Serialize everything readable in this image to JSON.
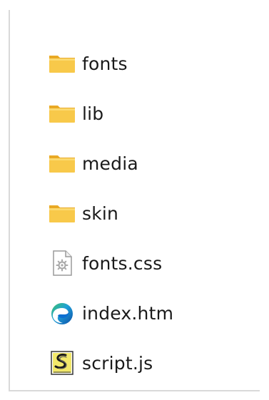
{
  "explorer": {
    "items": [
      {
        "name": "fonts",
        "type": "folder",
        "icon": "folder-icon"
      },
      {
        "name": "lib",
        "type": "folder",
        "icon": "folder-icon"
      },
      {
        "name": "media",
        "type": "folder",
        "icon": "folder-icon"
      },
      {
        "name": "skin",
        "type": "folder",
        "icon": "folder-icon"
      },
      {
        "name": "fonts.css",
        "type": "file",
        "icon": "css-file-icon"
      },
      {
        "name": "index.htm",
        "type": "file",
        "icon": "edge-browser-icon"
      },
      {
        "name": "script.js",
        "type": "file",
        "icon": "javascript-file-icon"
      }
    ]
  },
  "colors": {
    "folder_body": "#F8C94A",
    "folder_tab": "#E9A924",
    "edge_blue": "#0C6FD1",
    "edge_green": "#3DC26B",
    "js_yellow": "#F2E86A"
  }
}
